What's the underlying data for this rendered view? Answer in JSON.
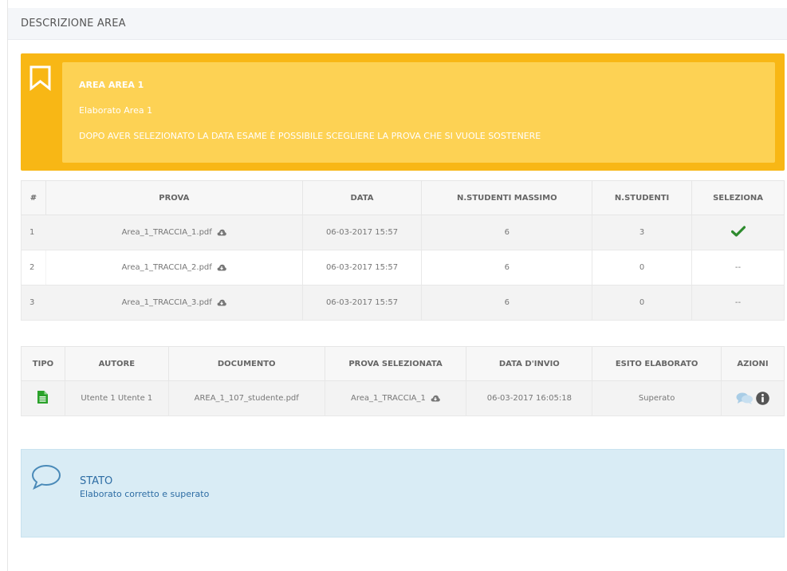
{
  "header": {
    "title": "DESCRIZIONE AREA"
  },
  "alert": {
    "line1": "AREA AREA 1",
    "line2": "Elaborato Area 1",
    "line3": "DOPO AVER SELEZIONATO LA DATA ESAME È POSSIBILE SCEGLIERE LA PROVA CHE SI VUOLE SOSTENERE",
    "icon": "bookmark-icon"
  },
  "prove": {
    "headers": {
      "num": "#",
      "prova": "PROVA",
      "data": "DATA",
      "max": "N.STUDENTI MASSIMO",
      "studenti": "N.STUDENTI",
      "seleziona": "SELEZIONA"
    },
    "rows": [
      {
        "num": "1",
        "prova": "Area_1_TRACCIA_1.pdf",
        "data": "06-03-2017 15:57",
        "max": "6",
        "studenti": "3",
        "seleziona": ""
      },
      {
        "num": "2",
        "prova": "Area_1_TRACCIA_2.pdf",
        "data": "06-03-2017 15:57",
        "max": "6",
        "studenti": "0",
        "seleziona": "--"
      },
      {
        "num": "3",
        "prova": "Area_1_TRACCIA_3.pdf",
        "data": "06-03-2017 15:57",
        "max": "6",
        "studenti": "0",
        "seleziona": "--"
      }
    ]
  },
  "elaborati": {
    "headers": {
      "tipo": "TIPO",
      "autore": "AUTORE",
      "documento": "DOCUMENTO",
      "prova": "PROVA SELEZIONATA",
      "invio": "DATA D'INVIO",
      "esito": "ESITO ELABORATO",
      "azioni": "AZIONI"
    },
    "rows": [
      {
        "autore": "Utente 1 Utente 1",
        "documento": "AREA_1_107_studente.pdf",
        "prova": "Area_1_TRACCIA_1",
        "invio": "06-03-2017 16:05:18",
        "esito": "Superato"
      }
    ]
  },
  "stato": {
    "title": "STATO",
    "description": "Elaborato corretto e superato"
  },
  "colors": {
    "warning": "#f8b715",
    "warning_inner": "#fdd254",
    "success": "#2e8b2e",
    "info_bg": "#d9ecf5",
    "info_text": "#2e6da4"
  }
}
